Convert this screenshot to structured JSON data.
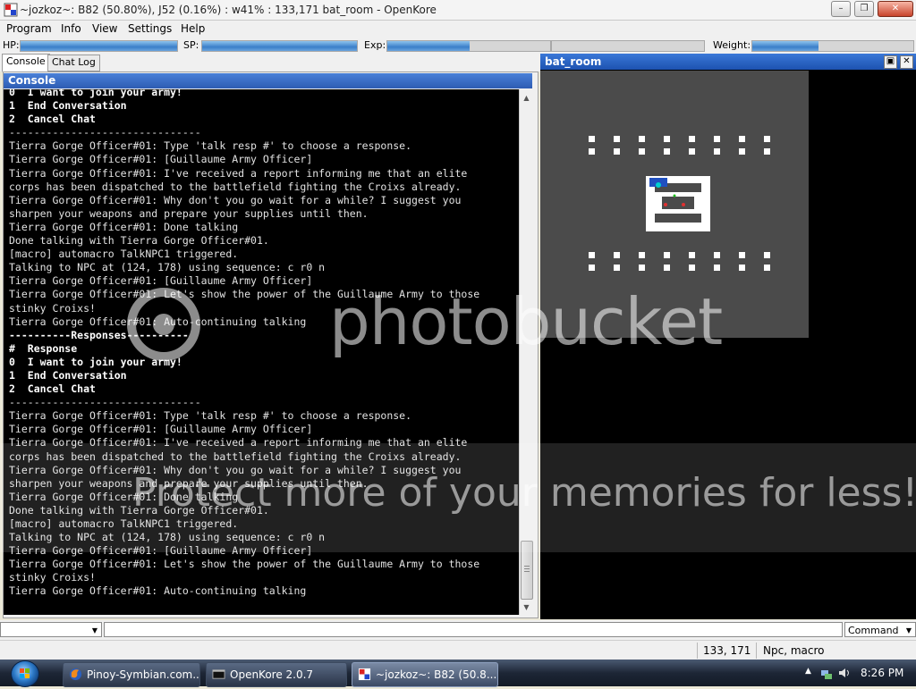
{
  "window": {
    "title": "~jozkoz~: B82 (50.80%), J52 (0.16%) : w41% : 133,171 bat_room - OpenKore"
  },
  "menu": [
    "Program",
    "Info",
    "View",
    "Settings",
    "Help"
  ],
  "stats": {
    "hp_label": "HP:",
    "hp_fraction": 1.0,
    "sp_label": "SP:",
    "sp_fraction": 1.0,
    "exp_label": "Exp:",
    "base_exp_fraction": 0.508,
    "job_exp_fraction": 0.0016,
    "weight_label": "Weight:",
    "weight_fraction": 0.41
  },
  "tabs": {
    "console": "Console",
    "chat_log": "Chat Log"
  },
  "console": {
    "header": "Console",
    "lines": [
      {
        "text": "0  I want to join your army!",
        "bold": true
      },
      {
        "text": "1  End Conversation",
        "bold": true
      },
      {
        "text": "2  Cancel Chat",
        "bold": true
      },
      {
        "text": "-------------------------------",
        "bold": false
      },
      {
        "text": "Tierra Gorge Officer#01: Type 'talk resp #' to choose a response.",
        "bold": false
      },
      {
        "text": "Tierra Gorge Officer#01: [Guillaume Army Officer]",
        "bold": false
      },
      {
        "text": "Tierra Gorge Officer#01: I've received a report informing me that an elite",
        "bold": false
      },
      {
        "text": "corps has been dispatched to the battlefield fighting the Croixs already.",
        "bold": false
      },
      {
        "text": "Tierra Gorge Officer#01: Why don't you go wait for a while? I suggest you",
        "bold": false
      },
      {
        "text": "sharpen your weapons and prepare your supplies until then.",
        "bold": false
      },
      {
        "text": "Tierra Gorge Officer#01: Done talking",
        "bold": false
      },
      {
        "text": "Done talking with Tierra Gorge Officer#01.",
        "bold": false
      },
      {
        "text": "[macro] automacro TalkNPC1 triggered.",
        "bold": false
      },
      {
        "text": "Talking to NPC at (124, 178) using sequence: c r0 n",
        "bold": false
      },
      {
        "text": "Tierra Gorge Officer#01: [Guillaume Army Officer]",
        "bold": false
      },
      {
        "text": "Tierra Gorge Officer#01: Let's show the power of the Guillaume Army to those",
        "bold": false
      },
      {
        "text": "stinky Croixs!",
        "bold": false
      },
      {
        "text": "Tierra Gorge Officer#01: Auto-continuing talking",
        "bold": false
      },
      {
        "text": "----------Responses----------",
        "bold": true
      },
      {
        "text": "#  Response",
        "bold": true
      },
      {
        "text": "0  I want to join your army!",
        "bold": true
      },
      {
        "text": "1  End Conversation",
        "bold": true
      },
      {
        "text": "2  Cancel Chat",
        "bold": true
      },
      {
        "text": "-------------------------------",
        "bold": false
      },
      {
        "text": "Tierra Gorge Officer#01: Type 'talk resp #' to choose a response.",
        "bold": false
      },
      {
        "text": "Tierra Gorge Officer#01: [Guillaume Army Officer]",
        "bold": false
      },
      {
        "text": "Tierra Gorge Officer#01: I've received a report informing me that an elite",
        "bold": false
      },
      {
        "text": "corps has been dispatched to the battlefield fighting the Croixs already.",
        "bold": false
      },
      {
        "text": "Tierra Gorge Officer#01: Why don't you go wait for a while? I suggest you",
        "bold": false
      },
      {
        "text": "sharpen your weapons and prepare your supplies until then.",
        "bold": false
      },
      {
        "text": "Tierra Gorge Officer#01: Done talking",
        "bold": false
      },
      {
        "text": "Done talking with Tierra Gorge Officer#01.",
        "bold": false
      },
      {
        "text": "[macro] automacro TalkNPC1 triggered.",
        "bold": false
      },
      {
        "text": "Talking to NPC at (124, 178) using sequence: c r0 n",
        "bold": false
      },
      {
        "text": "Tierra Gorge Officer#01: [Guillaume Army Officer]",
        "bold": false
      },
      {
        "text": "Tierra Gorge Officer#01: Let's show the power of the Guillaume Army to those",
        "bold": false
      },
      {
        "text": "stinky Croixs!",
        "bold": false
      },
      {
        "text": "Tierra Gorge Officer#01: Auto-continuing talking",
        "bold": false
      }
    ]
  },
  "map": {
    "title": "bat_room"
  },
  "input": {
    "mode": "Command"
  },
  "status": {
    "position": "133, 171",
    "activity": "Npc, macro"
  },
  "watermark": {
    "brand": "photobucket",
    "slogan": "Protect more of your memories for less!"
  },
  "taskbar": {
    "items": [
      {
        "label": "Pinoy-Symbian.com...",
        "icon": "firefox-icon"
      },
      {
        "label": "OpenKore 2.0.7",
        "icon": "terminal-icon"
      },
      {
        "label": "~jozkoz~: B82 (50.8...",
        "icon": "openkore-icon"
      }
    ],
    "clock": "8:26 PM"
  },
  "colors": {
    "console_bg": "#000000",
    "header_blue": "#2d5cb3",
    "map_floor": "#4a4a4a",
    "bar_fill": "#3b7fc9"
  }
}
